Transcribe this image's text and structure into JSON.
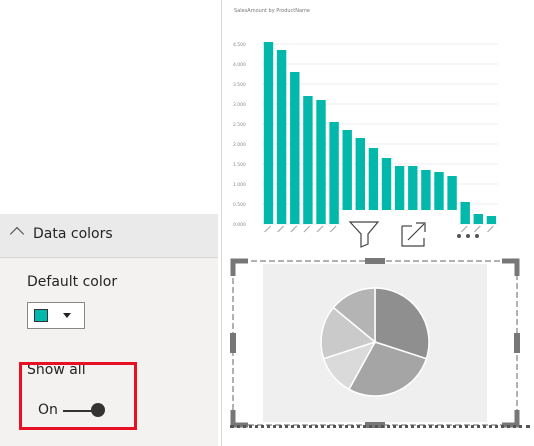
{
  "format_pane": {
    "section_title": "Data colors",
    "default_color_label": "Default color",
    "default_color": "#01b8aa",
    "show_all_label": "Show all",
    "toggle_state": "On"
  },
  "colors": {
    "accent": "#01b8aa",
    "highlight": "#e81123"
  },
  "icons": {
    "collapse": "chevron-up-icon",
    "filter": "filter-icon",
    "focus_mode": "focus-mode-icon",
    "more": "more-options-icon"
  },
  "chart_data": [
    {
      "type": "bar",
      "title": "SalesAmount by ProductName",
      "values": [
        4.55,
        4.35,
        3.8,
        3.2,
        3.1,
        2.55,
        2.35,
        2.15,
        1.9,
        1.65,
        1.45,
        1.45,
        1.35,
        1.3,
        1.2,
        0.55,
        0.25,
        0.2
      ],
      "ylim": [
        0,
        5
      ],
      "yticks": [
        "0.000",
        "0.500",
        "1.000",
        "1.500",
        "2.000",
        "2.500",
        "3.000",
        "3.500",
        "4.000",
        "4.500"
      ],
      "color": "#01b8aa",
      "grid": true
    },
    {
      "type": "pie",
      "values": [
        30,
        28,
        12,
        16,
        14
      ],
      "colors": [
        "#8f8f8f",
        "#a5a5a5",
        "#dadada",
        "#cacaca",
        "#b4b4b4"
      ]
    }
  ]
}
